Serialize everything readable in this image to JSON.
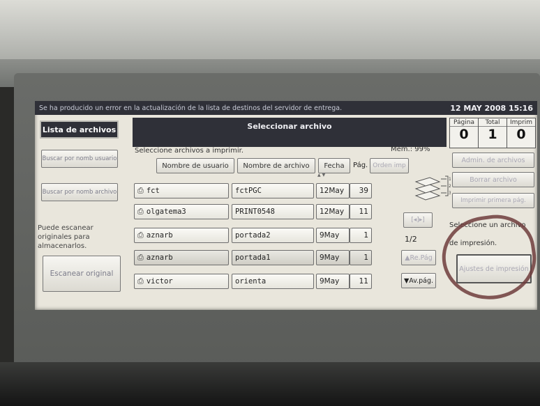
{
  "status": {
    "message": "Se ha producido un error en la actualización de la lista de destinos del servidor de entrega.",
    "datetime": "12 MAY   2008 15:16"
  },
  "left": {
    "tab_label": "Lista de archivos",
    "search_user": "Buscar por nomb usuario",
    "search_file": "Buscar por nomb archivo",
    "info_text": "Puede escanear originales para almacenarlos.",
    "scan_button": "Escanear original"
  },
  "header": {
    "title": "Seleccionar archivo",
    "prompt": "Seleccione archivos a imprimir.",
    "memory": "Mem.:  99%"
  },
  "counters": [
    {
      "label": "Página",
      "value": "0"
    },
    {
      "label": "Total",
      "value": "1"
    },
    {
      "label": "Imprim",
      "value": "0"
    }
  ],
  "columns": {
    "user": "Nombre de usuario",
    "file": "Nombre de archivo",
    "date": "Fecha",
    "pages": "Pág.",
    "order": "Orden imp"
  },
  "rows": [
    {
      "user": "fct",
      "file": "fctPGC",
      "date": "12May",
      "pages": "39"
    },
    {
      "user": "olgatema3",
      "file": "PRINT0548",
      "date": "12May",
      "pages": "11"
    },
    {
      "user": "aznarb",
      "file": "portada2",
      "date": "9May",
      "pages": "1"
    },
    {
      "user": "aznarb",
      "file": "portada1",
      "date": "9May",
      "pages": "1"
    },
    {
      "user": "victor",
      "file": "orienta",
      "date": "9May",
      "pages": "11"
    }
  ],
  "pager": {
    "clear_label": "[◂]▸]",
    "page": "1/2",
    "prev": "▲Re.Pág",
    "next": "▼Av.pág."
  },
  "right": {
    "manage": "Admin. de archivos",
    "delete": "Borrar archivo",
    "print_first": "Imprimir primera pág.",
    "select_hint_1": "Seleccione un archivo",
    "select_hint_2": "de impresión.",
    "print_settings": "Ajustes de impresión"
  },
  "colors": {
    "dark_bar": "#2f3038",
    "screen_bg": "#e9e6dc",
    "marker_circle": "#6e3c3c"
  }
}
